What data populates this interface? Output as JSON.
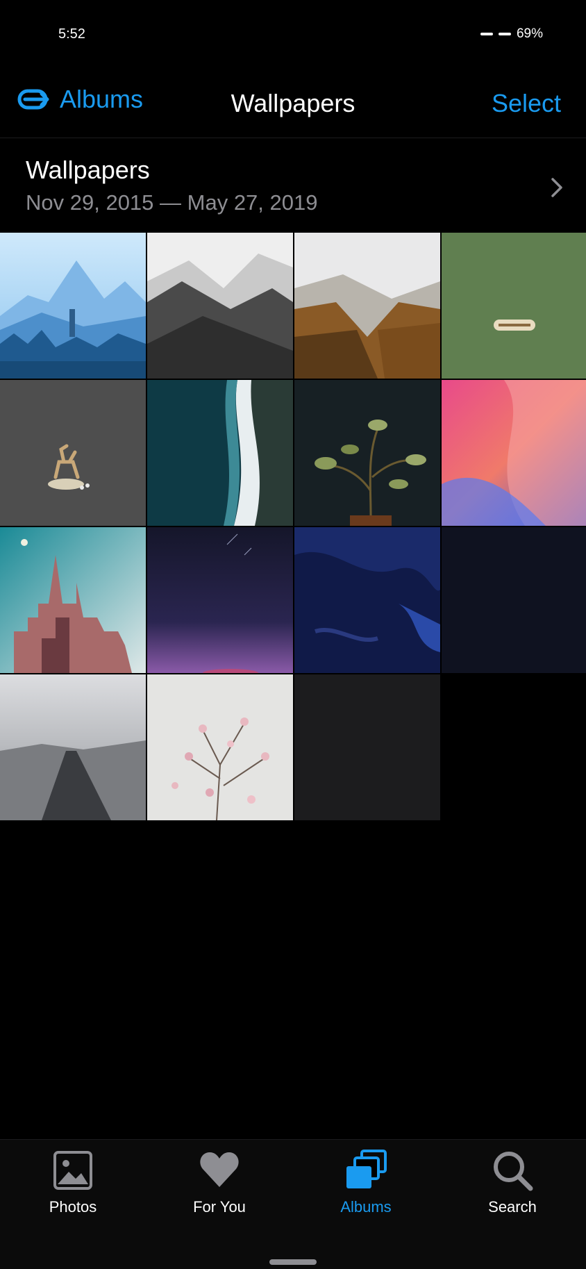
{
  "status": {
    "time": "5:52",
    "battery": "69%"
  },
  "nav": {
    "back_label": "Albums",
    "title": "Wallpapers",
    "select_label": "Select"
  },
  "album": {
    "title": "Wallpapers",
    "dates": "Nov 29, 2015 — May 27, 2019"
  },
  "photos": [
    "mountain-lighthouse",
    "snowy-peaks",
    "misty-valley",
    "love-hate-pattern",
    "deer-illustration",
    "aerial-coastline",
    "potted-plant",
    "pink-gradient",
    "castle-moon",
    "purple-night-sky",
    "deep-blue-ocean",
    "dark-navy",
    "foggy-path",
    "cherry-blossom",
    "dark-gray"
  ],
  "tabs": [
    {
      "id": "photos",
      "label": "Photos",
      "icon": "photos-icon",
      "active": false
    },
    {
      "id": "for-you",
      "label": "For You",
      "icon": "heart-icon",
      "active": false
    },
    {
      "id": "albums",
      "label": "Albums",
      "icon": "albums-icon",
      "active": true
    },
    {
      "id": "search",
      "label": "Search",
      "icon": "search-icon",
      "active": false
    }
  ],
  "colors": {
    "accent": "#1a9bf0",
    "background": "#000000",
    "secondary_text": "#8e8e93"
  }
}
